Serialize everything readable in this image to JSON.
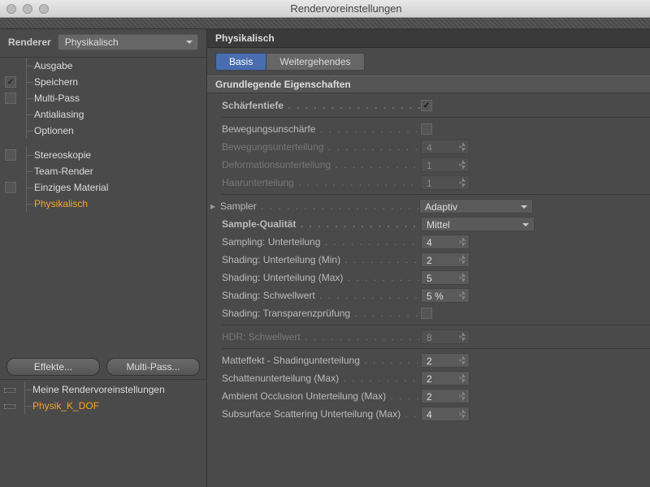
{
  "window": {
    "title": "Rendervoreinstellungen"
  },
  "renderer": {
    "label": "Renderer",
    "value": "Physikalisch"
  },
  "tree": [
    {
      "cb": "none",
      "label": "Ausgabe"
    },
    {
      "cb": "checked",
      "label": "Speichern"
    },
    {
      "cb": "off",
      "label": "Multi-Pass"
    },
    {
      "cb": "none",
      "label": "Antialiasing"
    },
    {
      "cb": "none",
      "label": "Optionen"
    },
    {
      "cb": "off",
      "label": "Stereoskopie"
    },
    {
      "cb": "none",
      "label": "Team-Render"
    },
    {
      "cb": "off",
      "label": "Einziges Material"
    },
    {
      "cb": "none",
      "label": "Physikalisch",
      "selected": true
    }
  ],
  "buttons": {
    "effects": "Effekte...",
    "multipass": "Multi-Pass..."
  },
  "presets": [
    {
      "label": "Meine Rendervoreinstellungen"
    },
    {
      "label": "Physik_K_DOF",
      "selected": true
    }
  ],
  "panel": {
    "title": "Physikalisch",
    "tabs": {
      "basis": "Basis",
      "advanced": "Weitergehendes"
    },
    "section": "Grundlegende Eigenschaften",
    "rows": {
      "dof": {
        "label": "Schärfentiefe",
        "checked": true
      },
      "motion": {
        "label": "Bewegungsunschärfe",
        "checked": false
      },
      "motion_sub": {
        "label": "Bewegungsunterteilung",
        "value": "4"
      },
      "deform_sub": {
        "label": "Deformationsunterteilung",
        "value": "1"
      },
      "hair_sub": {
        "label": "Haarunterteilung",
        "value": "1"
      },
      "sampler": {
        "label": "Sampler",
        "value": "Adaptiv"
      },
      "sample_q": {
        "label": "Sample-Qualität",
        "value": "Mittel"
      },
      "samp_sub": {
        "label": "Sampling: Unterteilung",
        "value": "4"
      },
      "shade_min": {
        "label": "Shading: Unterteilung (Min)",
        "value": "2"
      },
      "shade_max": {
        "label": "Shading: Unterteilung (Max)",
        "value": "5"
      },
      "shade_thr": {
        "label": "Shading: Schwellwert",
        "value": "5 %"
      },
      "shade_trans": {
        "label": "Shading: Transparenzprüfung",
        "checked": false
      },
      "hdr_thr": {
        "label": "HDR: Schwellwert",
        "value": "8"
      },
      "matte": {
        "label": "Matteffekt - Shadingunterteilung",
        "value": "2"
      },
      "shadow": {
        "label": "Schattenunterteilung (Max)",
        "value": "2"
      },
      "ao": {
        "label": "Ambient Occlusion Unterteilung (Max)",
        "value": "2"
      },
      "sss": {
        "label": "Subsurface Scattering Unterteilung (Max)",
        "value": "4"
      }
    }
  }
}
